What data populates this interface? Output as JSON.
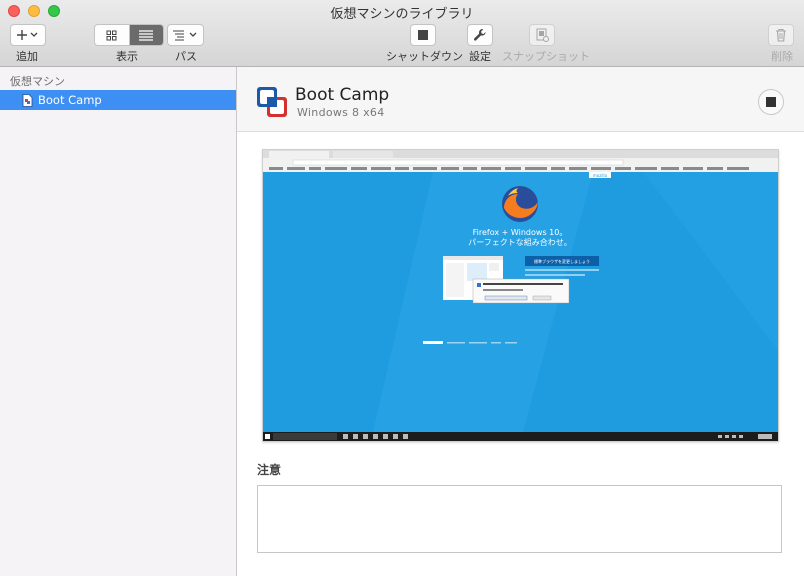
{
  "window": {
    "title": "仮想マシンのライブラリ"
  },
  "toolbar": {
    "add_label": "追加",
    "view_label": "表示",
    "path_label": "パス",
    "shutdown_label": "シャットダウン",
    "settings_label": "設定",
    "snapshot_label": "スナップショット",
    "delete_label": "削除"
  },
  "sidebar": {
    "section_title": "仮想マシン",
    "items": [
      {
        "label": "Boot Camp",
        "selected": true
      }
    ]
  },
  "vm": {
    "name": "Boot Camp",
    "os": "Windows 8 x64"
  },
  "screenshot": {
    "brand_badge": "mozilla",
    "headline_1": "Firefox + Windows 10。",
    "headline_2": "パーフェクトな組み合わせ。",
    "cta": "標準ブラウザを変更しましょう"
  },
  "notes": {
    "title": "注意",
    "value": ""
  },
  "colors": {
    "selection": "#3d8ff3",
    "desktop_blue": "#1f9be0",
    "taskbar": "#1c1c1c"
  }
}
